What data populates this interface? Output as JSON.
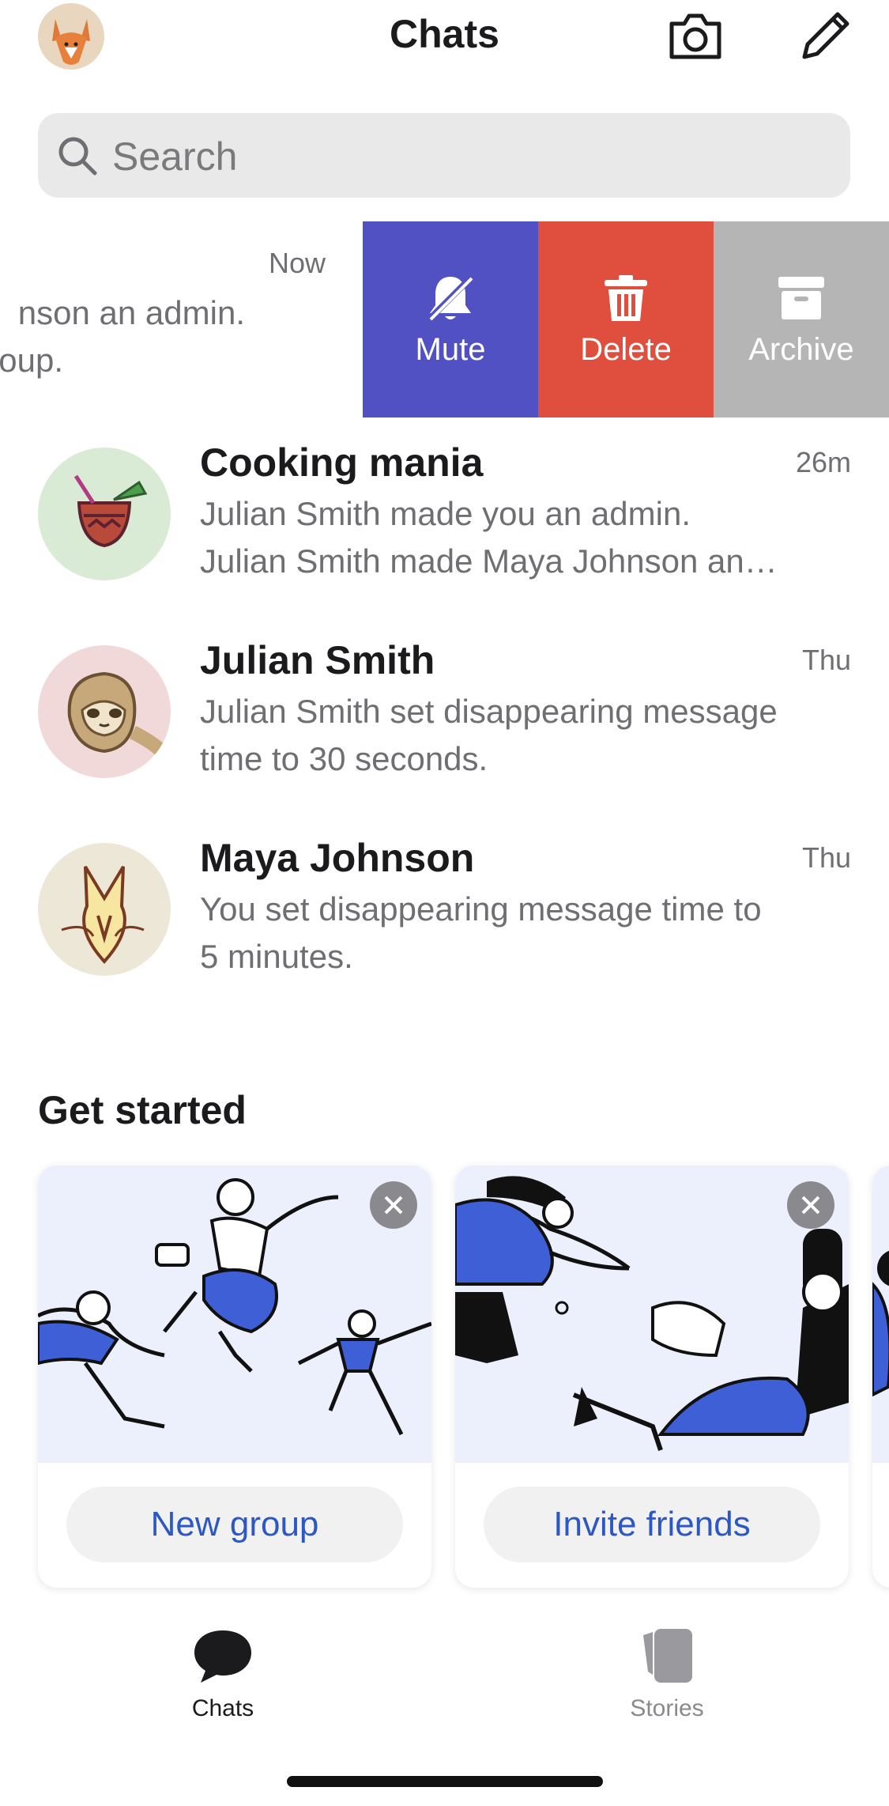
{
  "header": {
    "title": "Chats",
    "camera_icon": "camera-icon",
    "compose_icon": "pencil-icon"
  },
  "search": {
    "placeholder": "Search"
  },
  "swiped_row": {
    "time": "Now",
    "line1": "nson an admin.",
    "line2": "oup.",
    "actions": [
      {
        "label": "Mute",
        "icon": "bell-slash-icon",
        "color": "#5151c4"
      },
      {
        "label": "Delete",
        "icon": "trash-icon",
        "color": "#e04e3d"
      },
      {
        "label": "Archive",
        "icon": "archive-icon",
        "color": "#b5b5b5"
      }
    ]
  },
  "chats": [
    {
      "name": "Cooking mania",
      "time": "26m",
      "line1": "Julian  Smith made you an admin.",
      "line2": "Julian  Smith made Maya Johnson an…"
    },
    {
      "name": "Julian Smith",
      "time": "Thu",
      "line1": "Julian  Smith set disappearing message",
      "line2": "time to 30 seconds."
    },
    {
      "name": "Maya Johnson",
      "time": "Thu",
      "line1": "You set disappearing message time to",
      "line2": "5 minutes."
    }
  ],
  "get_started": {
    "title": "Get started",
    "cards": [
      {
        "label": "New group"
      },
      {
        "label": "Invite friends"
      }
    ]
  },
  "tabbar": {
    "tabs": [
      {
        "label": "Chats",
        "icon": "chat-bubble-icon",
        "active": true
      },
      {
        "label": "Stories",
        "icon": "stories-icon",
        "active": false
      }
    ]
  },
  "colors": {
    "accent_blue": "#2c58c4",
    "mute": "#5151c4",
    "delete": "#e04e3d",
    "archive": "#b5b5b5"
  }
}
